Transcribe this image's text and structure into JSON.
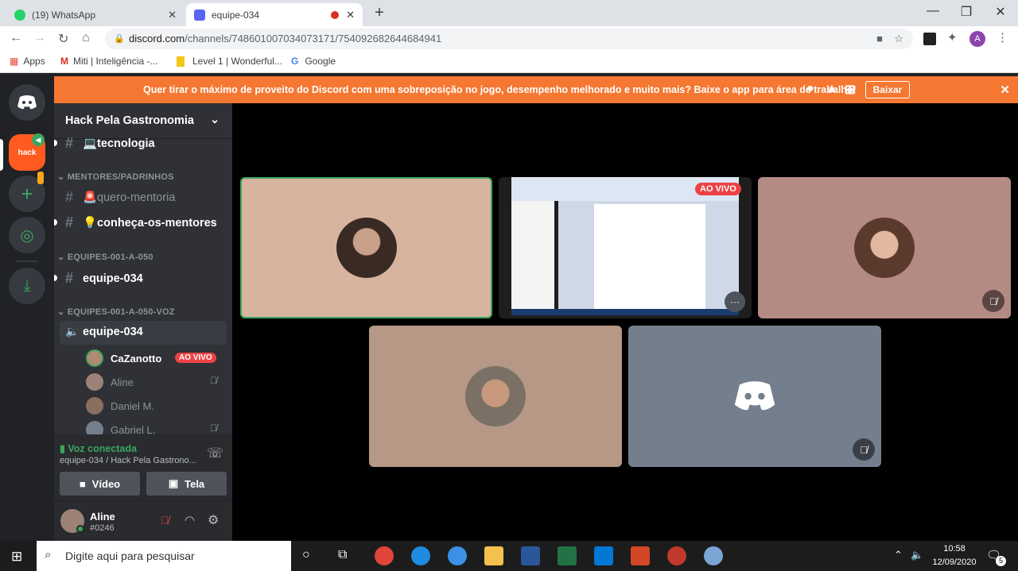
{
  "browser": {
    "tabs": [
      {
        "label": "(19) WhatsApp",
        "close": "✕"
      },
      {
        "label": "equipe-034",
        "close": "✕"
      }
    ],
    "new_tab": "+",
    "window_controls": {
      "minimize": "—",
      "maximize": "❐",
      "close": "✕"
    },
    "url_host": "discord.com",
    "url_path": "/channels/748601007034073171/754092682644684941",
    "bookmarks": [
      {
        "label": "Apps"
      },
      {
        "label": "Miti | Inteligência -..."
      },
      {
        "label": "Level 1 | Wonderful..."
      },
      {
        "label": "Google"
      }
    ],
    "profile_initial": "A"
  },
  "banner": {
    "text": "Quer tirar o máximo de proveito do Discord com uma sobreposição no jogo, desempenho melhorado e muito mais? Baixe o app para área de trabalho!",
    "button": "Baixar",
    "close": "✕"
  },
  "server": {
    "name": "Hack Pela Gastronomia",
    "channels": [
      {
        "label": "💻tecnologia"
      },
      {
        "category": "MENTORES/PADRINHOS"
      },
      {
        "label": "🚨quero-mentoria"
      },
      {
        "label": "💡conheça-os-mentores"
      },
      {
        "category": "EQUIPES-001-A-050"
      },
      {
        "label": "equipe-034"
      },
      {
        "category": "EQUIPES-001-A-050-VOZ"
      },
      {
        "label": "equipe-034"
      }
    ],
    "voice_users": [
      {
        "name": "CaZanotto",
        "badge": "AO VIVO"
      },
      {
        "name": "Aline",
        "muted": true
      },
      {
        "name": "Daniel M."
      },
      {
        "name": "Gabriel L.",
        "muted": true
      }
    ],
    "guild_small_label": "hack"
  },
  "voice_panel": {
    "status": "Voz conectada",
    "location": "equipe-034 / Hack Pela Gastrono...",
    "video_label": "Vídeo",
    "screen_label": "Tela"
  },
  "user_panel": {
    "name": "Aline",
    "tag": "#0246"
  },
  "stage": {
    "live_badge": "AO VIVO",
    "more": "···"
  },
  "taskbar": {
    "search_placeholder": "Digite aqui para pesquisar",
    "time": "10:58",
    "date": "12/09/2020",
    "notif_count": "5"
  },
  "colors": {
    "discord_blurple": "#5865f2",
    "banner": "#f57731",
    "live": "#ed4245",
    "voice_green": "#3ba55d"
  }
}
